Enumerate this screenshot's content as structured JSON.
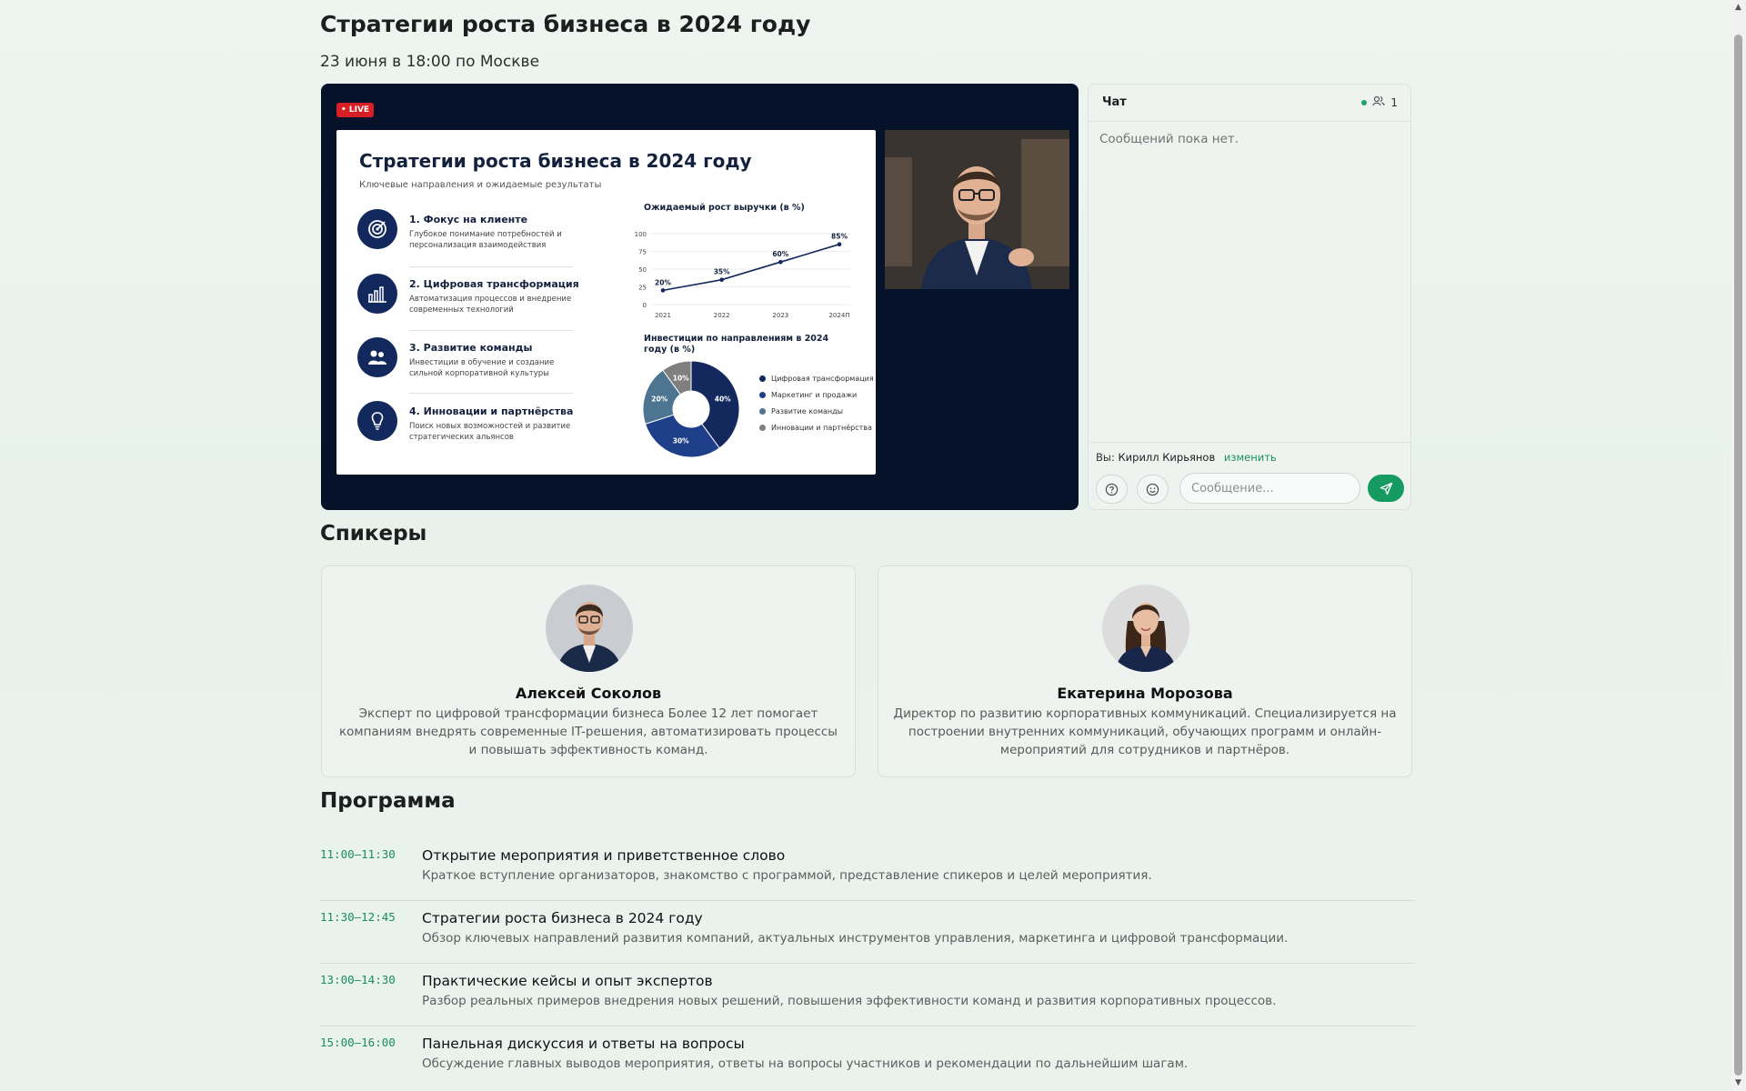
{
  "event": {
    "title": "Стратегии роста бизнеса в 2024 году",
    "datetime": "23 июня в 18:00 по Москве"
  },
  "stream": {
    "live_badge": "• LIVE",
    "slide": {
      "title": "Стратегии роста бизнеса в 2024 году",
      "subtitle": "Ключевые направления и ожидаемые результаты",
      "items": [
        {
          "title": "1. Фокус на клиенте",
          "desc": "Глубокое понимание потребностей и персонализация взаимодействия",
          "icon": "target-icon"
        },
        {
          "title": "2. Цифровая трансформация",
          "desc": "Автоматизация процессов и внедрение современных технологий",
          "icon": "bar-chart-icon"
        },
        {
          "title": "3. Развитие команды",
          "desc": "Инвестиции в обучение и создание сильной корпоративной культуры",
          "icon": "team-icon"
        },
        {
          "title": "4. Инновации и партнёрства",
          "desc": "Поиск новых возможностей и развитие стратегических альянсов",
          "icon": "lightbulb-icon"
        }
      ],
      "line_chart_title": "Ожидаемый рост выручки (в %)",
      "pie_chart_title": "Инвестиции по направлениям в 2024 году (в %)"
    }
  },
  "chart_data": [
    {
      "type": "line",
      "title": "Ожидаемый рост выручки (в %)",
      "x": [
        "2021",
        "2022",
        "2023",
        "2024П"
      ],
      "values": [
        20,
        35,
        60,
        85
      ],
      "data_labels": [
        "20%",
        "35%",
        "60%",
        "85%"
      ],
      "y_ticks": [
        "0",
        "25",
        "50",
        "75",
        "100"
      ],
      "ylim": [
        0,
        100
      ],
      "color": "#13285c"
    },
    {
      "type": "pie",
      "title": "Инвестиции по направлениям в 2024 году (в %)",
      "categories": [
        "Цифровая трансформация",
        "Маркетинг и продажи",
        "Развитие команды",
        "Инновации и партнёрства"
      ],
      "values": [
        40,
        30,
        20,
        10
      ],
      "data_labels": [
        "40%",
        "30%",
        "20%",
        "10%"
      ],
      "colors": [
        "#13285c",
        "#1f3f8a",
        "#4d7591",
        "#7f7f7f"
      ],
      "donut": true
    }
  ],
  "chat": {
    "title": "Чат",
    "online_count": "1",
    "empty_text": "Сообщений пока нет.",
    "you_prefix": "Вы:",
    "user_name": "Кирилл Кирьянов",
    "change_label": "изменить",
    "input_placeholder": "Сообщение...",
    "input_value": ""
  },
  "speakers": {
    "heading": "Спикеры",
    "items": [
      {
        "name": "Алексей Соколов",
        "bio": "Эксперт по цифровой трансформации бизнеса Более 12 лет помогает компаниям внедрять современные IT-решения, автоматизировать процессы и повышать эффективность команд."
      },
      {
        "name": "Екатерина Морозова",
        "bio": "Директор по развитию корпоративных коммуникаций. Специализируется на построении внутренних коммуникаций, обучающих программ и онлайн-мероприятий для сотрудников и партнёров."
      }
    ]
  },
  "program": {
    "heading": "Программа",
    "items": [
      {
        "time": "11:00–11:30",
        "title": "Открытие мероприятия и приветственное слово",
        "desc": "Краткое вступление организаторов, знакомство с программой, представление спикеров и целей мероприятия."
      },
      {
        "time": "11:30–12:45",
        "title": "Стратегии роста бизнеса в 2024 году",
        "desc": "Обзор ключевых направлений развития компаний, актуальных инструментов управления, маркетинга и цифровой трансформации."
      },
      {
        "time": "13:00–14:30",
        "title": "Практические кейсы и опыт экспертов",
        "desc": "Разбор реальных примеров внедрения новых решений, повышения эффективности команд и развития корпоративных процессов."
      },
      {
        "time": "15:00–16:00",
        "title": "Панельная дискуссия и ответы на вопросы",
        "desc": "Обсуждение главных выводов мероприятия, ответы на вопросы участников и рекомендации по дальнейшим шагам."
      }
    ]
  }
}
